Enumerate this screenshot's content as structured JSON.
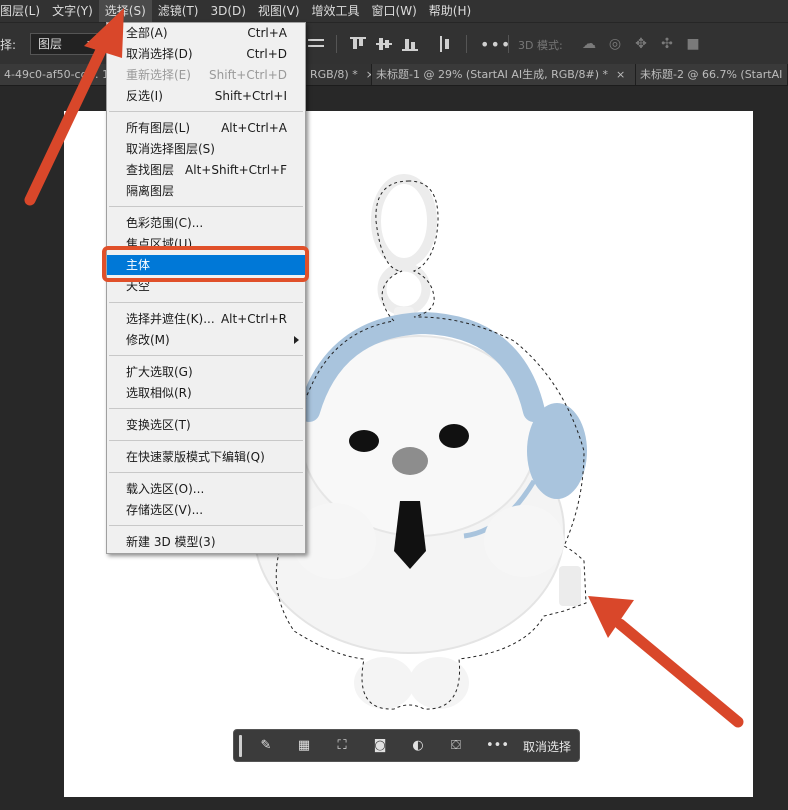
{
  "menubar": {
    "items": [
      "图层(L)",
      "文字(Y)",
      "选择(S)",
      "滤镜(T)",
      "3D(D)",
      "视图(V)",
      "增效工具",
      "窗口(W)",
      "帮助(H)"
    ],
    "active_index": 2
  },
  "options": {
    "select_label": "择:",
    "select_value": "图层",
    "mode3d_label": "3D 模式:",
    "more": "•••"
  },
  "tabs": [
    {
      "label": "4-49c0-af50-cd… 1d",
      "close": ""
    },
    {
      "label": "RGB/8) *",
      "close": "×"
    },
    {
      "label": "未标题-1 @ 29% (StartAI AI生成, RGB/8#) *",
      "close": "×"
    },
    {
      "label": "未标题-2 @ 66.7% (StartAI",
      "close": ""
    }
  ],
  "dropdown": {
    "items": [
      {
        "label": "全部(A)",
        "shortcut": "Ctrl+A"
      },
      {
        "label": "取消选择(D)",
        "shortcut": "Ctrl+D"
      },
      {
        "label": "重新选择(E)",
        "shortcut": "Shift+Ctrl+D",
        "disabled": true
      },
      {
        "label": "反选(I)",
        "shortcut": "Shift+Ctrl+I"
      },
      {
        "label": "所有图层(L)",
        "shortcut": "Alt+Ctrl+A"
      },
      {
        "label": "取消选择图层(S)",
        "shortcut": ""
      },
      {
        "label": "查找图层",
        "shortcut": "Alt+Shift+Ctrl+F"
      },
      {
        "label": "隔离图层",
        "shortcut": ""
      },
      {
        "label": "色彩范围(C)...",
        "shortcut": ""
      },
      {
        "label": "焦点区域(U)...",
        "shortcut": ""
      },
      {
        "label": "主体",
        "shortcut": ""
      },
      {
        "label": "天空",
        "shortcut": ""
      },
      {
        "label": "选择并遮住(K)...",
        "shortcut": "Alt+Ctrl+R"
      },
      {
        "label": "修改(M)",
        "shortcut": ""
      },
      {
        "label": "扩大选取(G)",
        "shortcut": ""
      },
      {
        "label": "选取相似(R)",
        "shortcut": ""
      },
      {
        "label": "变换选区(T)",
        "shortcut": ""
      },
      {
        "label": "在快速蒙版模式下编辑(Q)",
        "shortcut": ""
      },
      {
        "label": "载入选区(O)...",
        "shortcut": ""
      },
      {
        "label": "存储选区(V)...",
        "shortcut": ""
      },
      {
        "label": "新建 3D 模型(3)",
        "shortcut": ""
      }
    ],
    "highlighted_index": 10
  },
  "taskbar": {
    "deselect_label": "取消选择"
  },
  "colors": {
    "menu_bg": "#323232",
    "highlight_blue": "#0078d7",
    "annotation_red": "#e0502a"
  }
}
